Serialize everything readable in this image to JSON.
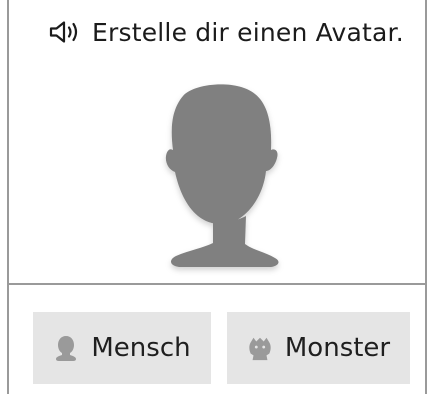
{
  "prompt": {
    "text": "Erstelle dir einen Avatar.",
    "icon": "speaker-icon"
  },
  "avatar": {
    "icon": "default-avatar-silhouette",
    "color": "#808080"
  },
  "choices": [
    {
      "label": "Mensch",
      "icon": "human-head-icon"
    },
    {
      "label": "Monster",
      "icon": "monster-head-icon"
    }
  ],
  "colors": {
    "button_bg": "#e5e5e5",
    "border": "#9a9a9a",
    "icon_gray": "#9a9a9a",
    "text": "#1b1b1b"
  }
}
